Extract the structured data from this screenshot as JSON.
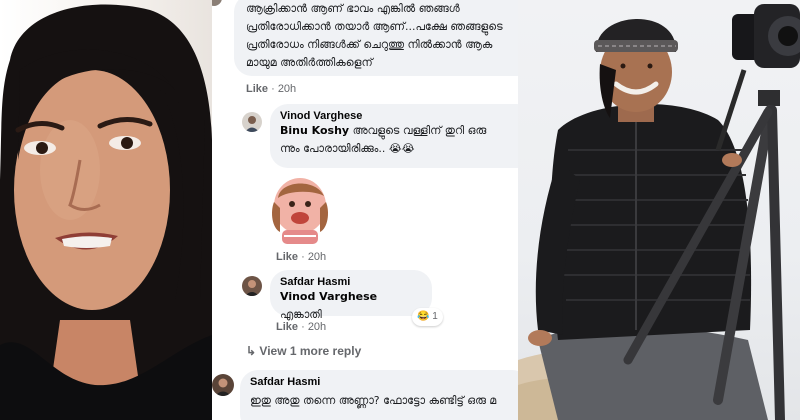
{
  "comment_top": {
    "lines": [
      "ആക്രിക്കാൻ ആണ് ഭാവം എങ്കിൽ ഞങ്ങൾ",
      "പ്രതിരോധിക്കാൻ തയാർ ആണ്...പക്ഷേ ഞങ്ങളുടെ",
      "പ്രതിരോധം നിങ്ങൾക്ക് ചെറുത്തു നിൽക്കാൻ ആക",
      "മായുമ അതിർത്തികളെന്"
    ],
    "like_label": "Like",
    "time": "20h"
  },
  "reply_vinod": {
    "author": "Vinod Varghese",
    "mention": "Binu Koshy",
    "text_line1": "അവളുടെ വള്ളിന് തുറി ഒരു",
    "text_line2": "ന്നും പോരായിരിക്കും..",
    "emoji": "😭😭",
    "like_label": "Like",
    "time": "20h"
  },
  "sticker": {
    "like_label": "Like",
    "time": "20h"
  },
  "reply_safdar": {
    "author": "Safdar Hasmi",
    "mention": "Vinod Varghese",
    "text": "എങ്കാതി",
    "emoji": "😂",
    "reaction_count": "1",
    "like_label": "Like",
    "time": "20h"
  },
  "view_more": {
    "arrow": "↳",
    "label": "View 1 more reply"
  },
  "bottom_comment": {
    "author": "Safdar Hasmi",
    "text": "ഇതു അതു തന്നെ അണ്ണാ? ഫോട്ടോ കണ്ടിട്ട് ഒരു മ"
  },
  "colors": {
    "bubble_bg": "#f0f2f5",
    "meta_text": "#65676b",
    "author_text": "#050505"
  }
}
